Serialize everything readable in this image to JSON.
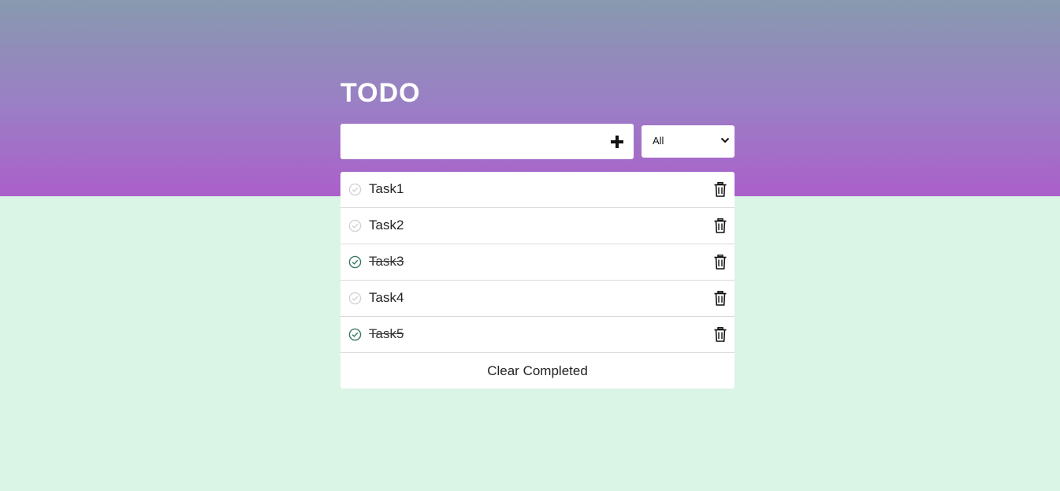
{
  "header": {
    "title": "TODO"
  },
  "input": {
    "value": "",
    "placeholder": ""
  },
  "filter": {
    "selected": "All"
  },
  "tasks": [
    {
      "label": "Task1",
      "completed": false
    },
    {
      "label": "Task2",
      "completed": false
    },
    {
      "label": "Task3",
      "completed": true
    },
    {
      "label": "Task4",
      "completed": false
    },
    {
      "label": "Task5",
      "completed": true
    }
  ],
  "footer": {
    "clear_label": "Clear Completed"
  },
  "icons": {
    "add": "plus-icon",
    "filter": "chevron-down-icon",
    "complete": "check-circle-icon",
    "delete": "trash-icon"
  },
  "colors": {
    "gradient_top": "#879aaf",
    "gradient_bottom": "#ab5fca",
    "page_background": "#daf4e6",
    "check_done": "#3d7a64",
    "check_pending": "#d3d3d3"
  }
}
